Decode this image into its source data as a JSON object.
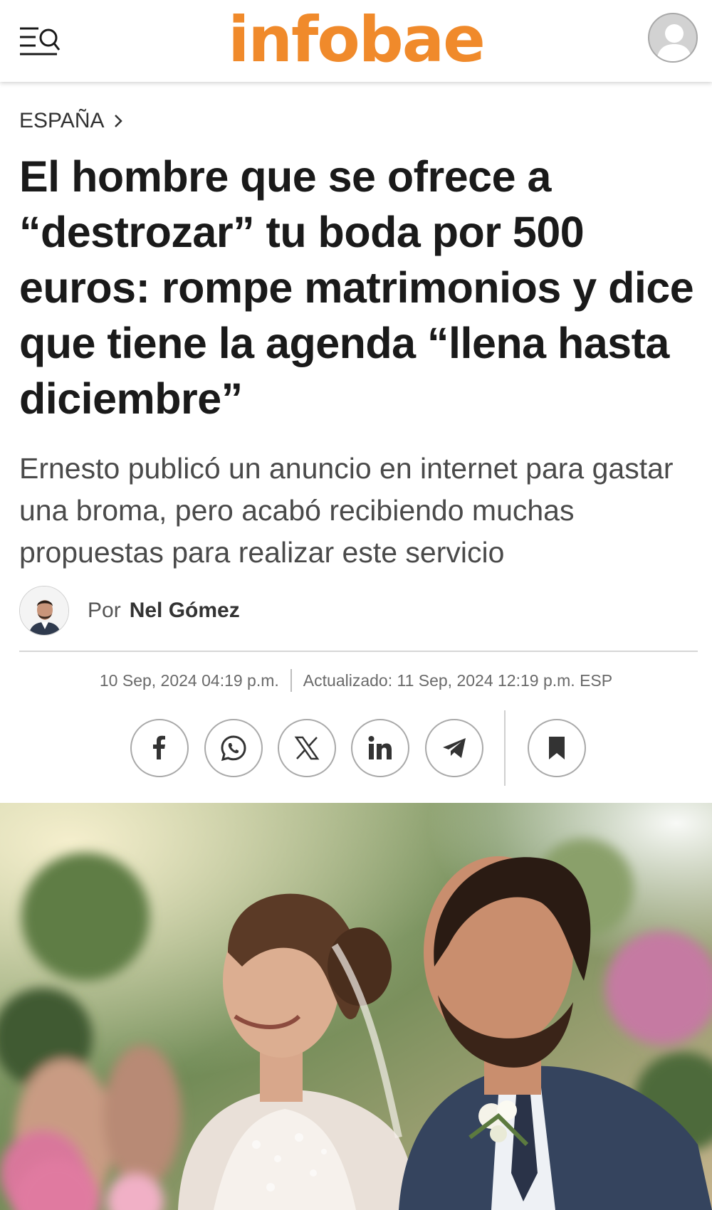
{
  "header": {
    "logo_text": "infobae",
    "brand_color": "#f08a2b",
    "menu_icon": "menu-search-icon",
    "account_icon": "user-avatar-icon"
  },
  "article": {
    "section": "ESPAÑA",
    "headline": "El hombre que se ofrece a “destrozar” tu boda por 500 euros: rompe matrimonios y dice que tiene la agenda “llena hasta diciembre”",
    "deck": "Ernesto publicó un anuncio en internet para gastar una broma, pero acabó recibiendo muchas propuestas para realizar este servicio",
    "byline_prefix": "Por",
    "author": "Nel Gómez",
    "published": "10 Sep, 2024 04:19 p.m.",
    "updated": "Actualizado: 11 Sep, 2024 12:19 p.m. ESP"
  },
  "share": {
    "icons": [
      "facebook-icon",
      "whatsapp-icon",
      "x-icon",
      "linkedin-icon",
      "telegram-icon",
      "bookmark-icon"
    ]
  },
  "hero_image": {
    "description_icon": "wedding-photo"
  }
}
